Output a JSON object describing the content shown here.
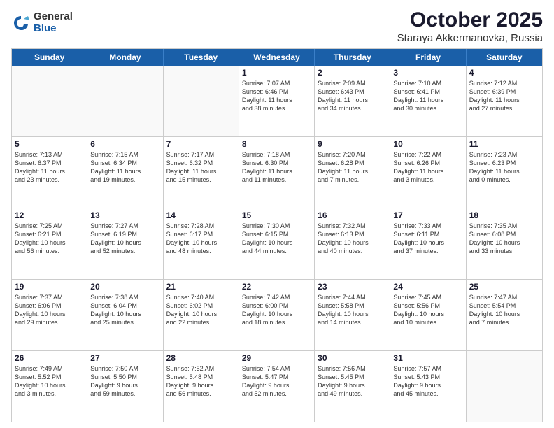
{
  "logo": {
    "general": "General",
    "blue": "Blue"
  },
  "title": {
    "month": "October 2025",
    "location": "Staraya Akkermanovka, Russia"
  },
  "header_days": [
    "Sunday",
    "Monday",
    "Tuesday",
    "Wednesday",
    "Thursday",
    "Friday",
    "Saturday"
  ],
  "rows": [
    [
      {
        "day": "",
        "text": ""
      },
      {
        "day": "",
        "text": ""
      },
      {
        "day": "",
        "text": ""
      },
      {
        "day": "1",
        "text": "Sunrise: 7:07 AM\nSunset: 6:46 PM\nDaylight: 11 hours\nand 38 minutes."
      },
      {
        "day": "2",
        "text": "Sunrise: 7:09 AM\nSunset: 6:43 PM\nDaylight: 11 hours\nand 34 minutes."
      },
      {
        "day": "3",
        "text": "Sunrise: 7:10 AM\nSunset: 6:41 PM\nDaylight: 11 hours\nand 30 minutes."
      },
      {
        "day": "4",
        "text": "Sunrise: 7:12 AM\nSunset: 6:39 PM\nDaylight: 11 hours\nand 27 minutes."
      }
    ],
    [
      {
        "day": "5",
        "text": "Sunrise: 7:13 AM\nSunset: 6:37 PM\nDaylight: 11 hours\nand 23 minutes."
      },
      {
        "day": "6",
        "text": "Sunrise: 7:15 AM\nSunset: 6:34 PM\nDaylight: 11 hours\nand 19 minutes."
      },
      {
        "day": "7",
        "text": "Sunrise: 7:17 AM\nSunset: 6:32 PM\nDaylight: 11 hours\nand 15 minutes."
      },
      {
        "day": "8",
        "text": "Sunrise: 7:18 AM\nSunset: 6:30 PM\nDaylight: 11 hours\nand 11 minutes."
      },
      {
        "day": "9",
        "text": "Sunrise: 7:20 AM\nSunset: 6:28 PM\nDaylight: 11 hours\nand 7 minutes."
      },
      {
        "day": "10",
        "text": "Sunrise: 7:22 AM\nSunset: 6:26 PM\nDaylight: 11 hours\nand 3 minutes."
      },
      {
        "day": "11",
        "text": "Sunrise: 7:23 AM\nSunset: 6:23 PM\nDaylight: 11 hours\nand 0 minutes."
      }
    ],
    [
      {
        "day": "12",
        "text": "Sunrise: 7:25 AM\nSunset: 6:21 PM\nDaylight: 10 hours\nand 56 minutes."
      },
      {
        "day": "13",
        "text": "Sunrise: 7:27 AM\nSunset: 6:19 PM\nDaylight: 10 hours\nand 52 minutes."
      },
      {
        "day": "14",
        "text": "Sunrise: 7:28 AM\nSunset: 6:17 PM\nDaylight: 10 hours\nand 48 minutes."
      },
      {
        "day": "15",
        "text": "Sunrise: 7:30 AM\nSunset: 6:15 PM\nDaylight: 10 hours\nand 44 minutes."
      },
      {
        "day": "16",
        "text": "Sunrise: 7:32 AM\nSunset: 6:13 PM\nDaylight: 10 hours\nand 40 minutes."
      },
      {
        "day": "17",
        "text": "Sunrise: 7:33 AM\nSunset: 6:11 PM\nDaylight: 10 hours\nand 37 minutes."
      },
      {
        "day": "18",
        "text": "Sunrise: 7:35 AM\nSunset: 6:08 PM\nDaylight: 10 hours\nand 33 minutes."
      }
    ],
    [
      {
        "day": "19",
        "text": "Sunrise: 7:37 AM\nSunset: 6:06 PM\nDaylight: 10 hours\nand 29 minutes."
      },
      {
        "day": "20",
        "text": "Sunrise: 7:38 AM\nSunset: 6:04 PM\nDaylight: 10 hours\nand 25 minutes."
      },
      {
        "day": "21",
        "text": "Sunrise: 7:40 AM\nSunset: 6:02 PM\nDaylight: 10 hours\nand 22 minutes."
      },
      {
        "day": "22",
        "text": "Sunrise: 7:42 AM\nSunset: 6:00 PM\nDaylight: 10 hours\nand 18 minutes."
      },
      {
        "day": "23",
        "text": "Sunrise: 7:44 AM\nSunset: 5:58 PM\nDaylight: 10 hours\nand 14 minutes."
      },
      {
        "day": "24",
        "text": "Sunrise: 7:45 AM\nSunset: 5:56 PM\nDaylight: 10 hours\nand 10 minutes."
      },
      {
        "day": "25",
        "text": "Sunrise: 7:47 AM\nSunset: 5:54 PM\nDaylight: 10 hours\nand 7 minutes."
      }
    ],
    [
      {
        "day": "26",
        "text": "Sunrise: 7:49 AM\nSunset: 5:52 PM\nDaylight: 10 hours\nand 3 minutes."
      },
      {
        "day": "27",
        "text": "Sunrise: 7:50 AM\nSunset: 5:50 PM\nDaylight: 9 hours\nand 59 minutes."
      },
      {
        "day": "28",
        "text": "Sunrise: 7:52 AM\nSunset: 5:48 PM\nDaylight: 9 hours\nand 56 minutes."
      },
      {
        "day": "29",
        "text": "Sunrise: 7:54 AM\nSunset: 5:47 PM\nDaylight: 9 hours\nand 52 minutes."
      },
      {
        "day": "30",
        "text": "Sunrise: 7:56 AM\nSunset: 5:45 PM\nDaylight: 9 hours\nand 49 minutes."
      },
      {
        "day": "31",
        "text": "Sunrise: 7:57 AM\nSunset: 5:43 PM\nDaylight: 9 hours\nand 45 minutes."
      },
      {
        "day": "",
        "text": ""
      }
    ]
  ]
}
